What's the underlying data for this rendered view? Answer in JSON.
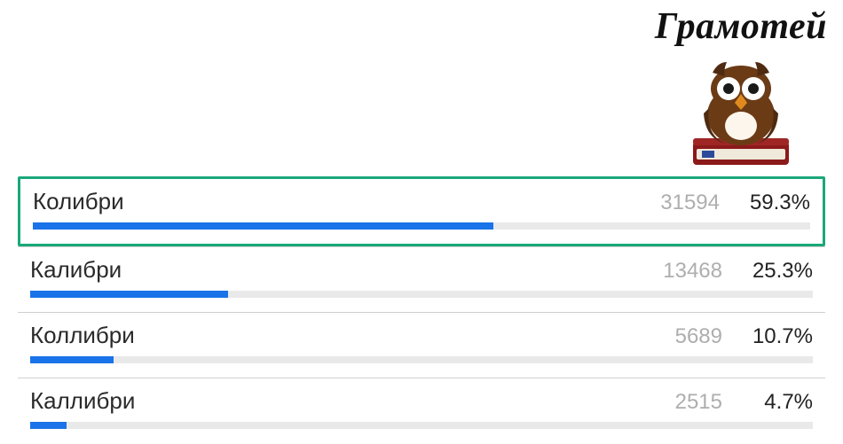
{
  "brand": {
    "title": "Грамотей",
    "logo_name": "owl-on-book-icon"
  },
  "chart_data": {
    "type": "bar",
    "title": "",
    "xlabel": "",
    "ylabel": "",
    "ylim": [
      0,
      100
    ],
    "categories": [
      "Колибри",
      "Калибри",
      "Коллибри",
      "Каллибри"
    ],
    "series": [
      {
        "name": "votes",
        "values": [
          31594,
          13468,
          5689,
          2515
        ]
      },
      {
        "name": "percent",
        "values": [
          59.3,
          25.3,
          10.7,
          4.7
        ]
      }
    ],
    "highlight_index": 0,
    "bar_color": "#1a73e8",
    "track_color": "#e9e9e9",
    "highlight_color": "#1aa87a"
  },
  "options": [
    {
      "label": "Колибри",
      "count": "31594",
      "pct": "59.3%",
      "width": "59.3%",
      "correct": true
    },
    {
      "label": "Калибри",
      "count": "13468",
      "pct": "25.3%",
      "width": "25.3%",
      "correct": false
    },
    {
      "label": "Коллибри",
      "count": "5689",
      "pct": "10.7%",
      "width": "10.7%",
      "correct": false
    },
    {
      "label": "Каллибри",
      "count": "2515",
      "pct": "4.7%",
      "width": "4.7%",
      "correct": false
    }
  ]
}
